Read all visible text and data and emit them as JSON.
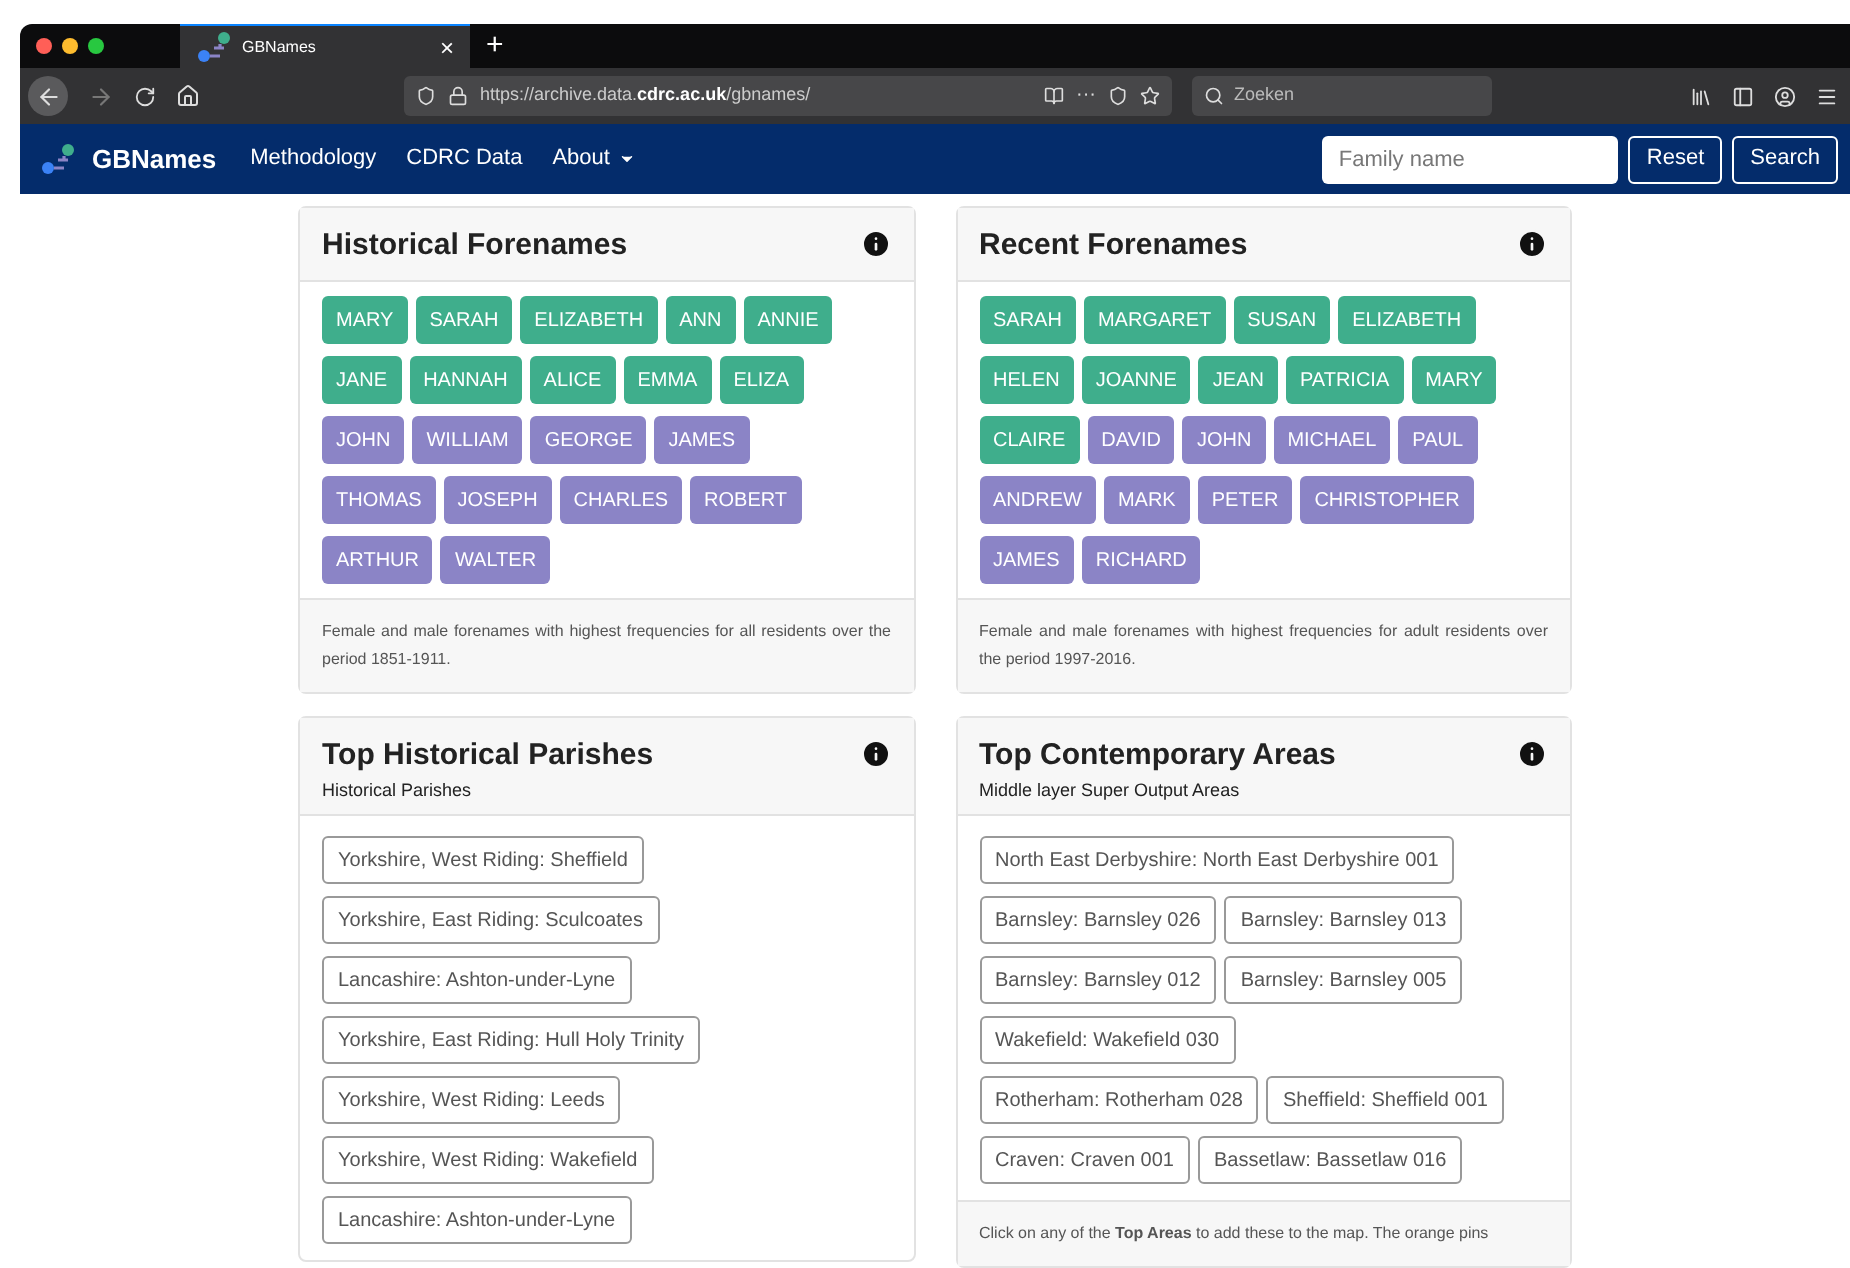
{
  "browser": {
    "tab_title": "GBNames",
    "tab_close": "×",
    "new_tab": "+",
    "url_prefix": "https://archive.data.",
    "url_bold": "cdrc.ac.uk",
    "url_suffix": "/gbnames/",
    "more": "···",
    "search_placeholder": "Zoeken"
  },
  "navbar": {
    "brand": "GBNames",
    "links": [
      {
        "label": "Methodology",
        "dropdown": false
      },
      {
        "label": "CDRC Data",
        "dropdown": false
      },
      {
        "label": "About",
        "dropdown": true
      }
    ],
    "search": {
      "placeholder": "Family name"
    },
    "buttons": [
      "Reset",
      "Search"
    ]
  },
  "cards": [
    {
      "title": "Historical Forenames",
      "kind": "names",
      "rows": [
        [
          {
            "label": "MARY",
            "color": "#3fae8c"
          },
          {
            "label": "SARAH",
            "color": "#3fae8c"
          },
          {
            "label": "ELIZABETH",
            "color": "#3fae8c"
          },
          {
            "label": "ANN",
            "color": "#3fae8c"
          },
          {
            "label": "ANNIE",
            "color": "#3fae8c"
          }
        ],
        [
          {
            "label": "JANE",
            "color": "#3fae8c"
          },
          {
            "label": "HANNAH",
            "color": "#3fae8c"
          },
          {
            "label": "ALICE",
            "color": "#3fae8c"
          },
          {
            "label": "EMMA",
            "color": "#3fae8c"
          },
          {
            "label": "ELIZA",
            "color": "#3fae8c"
          }
        ],
        [
          {
            "label": "JOHN",
            "color": "#8b84c6"
          },
          {
            "label": "WILLIAM",
            "color": "#8b84c6"
          },
          {
            "label": "GEORGE",
            "color": "#8b84c6"
          },
          {
            "label": "JAMES",
            "color": "#8b84c6"
          }
        ],
        [
          {
            "label": "THOMAS",
            "color": "#8b84c6"
          },
          {
            "label": "JOSEPH",
            "color": "#8b84c6"
          },
          {
            "label": "CHARLES",
            "color": "#8b84c6"
          },
          {
            "label": "ROBERT",
            "color": "#8b84c6"
          }
        ],
        [
          {
            "label": "ARTHUR",
            "color": "#8b84c6"
          },
          {
            "label": "WALTER",
            "color": "#8b84c6"
          }
        ]
      ],
      "footer": "Female and male forenames with highest frequencies for all residents over the period 1851-1911."
    },
    {
      "title": "Recent Forenames",
      "kind": "names",
      "rows": [
        [
          {
            "label": "SARAH",
            "color": "#3fae8c"
          },
          {
            "label": "MARGARET",
            "color": "#3fae8c"
          },
          {
            "label": "SUSAN",
            "color": "#3fae8c"
          },
          {
            "label": "ELIZABETH",
            "color": "#3fae8c"
          }
        ],
        [
          {
            "label": "HELEN",
            "color": "#3fae8c"
          },
          {
            "label": "JOANNE",
            "color": "#3fae8c"
          },
          {
            "label": "JEAN",
            "color": "#3fae8c"
          },
          {
            "label": "PATRICIA",
            "color": "#3fae8c"
          },
          {
            "label": "MARY",
            "color": "#3fae8c"
          }
        ],
        [
          {
            "label": "CLAIRE",
            "color": "#3fae8c"
          },
          {
            "label": "DAVID",
            "color": "#8b84c6"
          },
          {
            "label": "JOHN",
            "color": "#8b84c6"
          },
          {
            "label": "MICHAEL",
            "color": "#8b84c6"
          },
          {
            "label": "PAUL",
            "color": "#8b84c6"
          }
        ],
        [
          {
            "label": "ANDREW",
            "color": "#8b84c6"
          },
          {
            "label": "MARK",
            "color": "#8b84c6"
          },
          {
            "label": "PETER",
            "color": "#8b84c6"
          },
          {
            "label": "CHRISTOPHER",
            "color": "#8b84c6"
          }
        ],
        [
          {
            "label": "JAMES",
            "color": "#8b84c6"
          },
          {
            "label": "RICHARD",
            "color": "#8b84c6"
          }
        ]
      ],
      "footer": "Female and male forenames with highest frequencies for adult residents over the period 1997-2016."
    },
    {
      "title": "Top Historical Parishes",
      "subtitle": "Historical Parishes",
      "kind": "places",
      "rows": [
        [
          "Yorkshire, West Riding: Sheffield"
        ],
        [
          "Yorkshire, East Riding: Sculcoates"
        ],
        [
          "Lancashire: Ashton-under-Lyne"
        ],
        [
          "Yorkshire, East Riding: Hull Holy Trinity"
        ],
        [
          "Yorkshire, West Riding: Leeds"
        ],
        [
          "Yorkshire, West Riding: Wakefield"
        ],
        [
          "Lancashire: Ashton-under-Lyne"
        ]
      ]
    },
    {
      "title": "Top Contemporary Areas",
      "subtitle": "Middle layer Super Output Areas",
      "kind": "places",
      "rows": [
        [
          "North East Derbyshire: North East Derbyshire 001"
        ],
        [
          "Barnsley: Barnsley 026",
          "Barnsley: Barnsley 013"
        ],
        [
          "Barnsley: Barnsley 012",
          "Barnsley: Barnsley 005"
        ],
        [
          "Wakefield: Wakefield 030"
        ],
        [
          "Rotherham: Rotherham 028",
          "Sheffield: Sheffield 001"
        ],
        [
          "Craven: Craven 001",
          "Bassetlaw: Bassetlaw 016"
        ]
      ],
      "footer": "Click on any of the **Top Areas** to add these to the map. The orange pins"
    }
  ]
}
